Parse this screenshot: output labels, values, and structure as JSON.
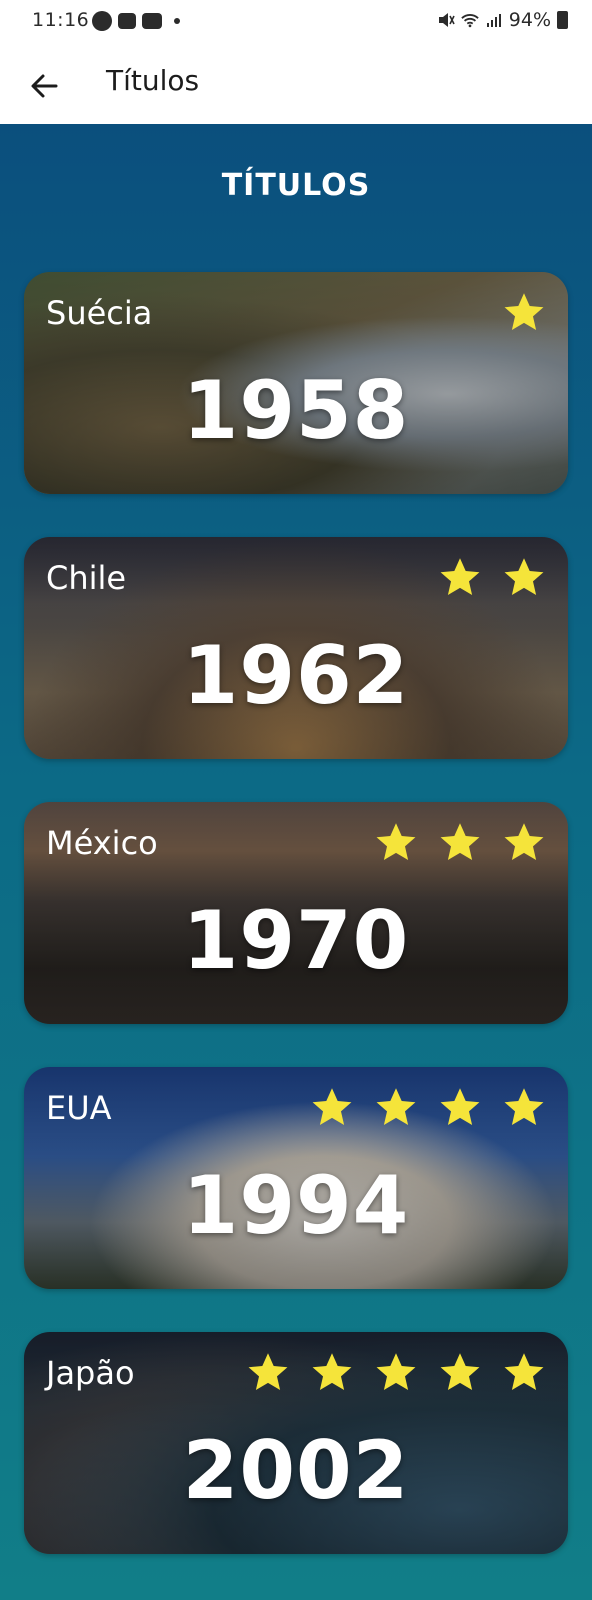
{
  "status_bar": {
    "time": "11:16",
    "battery": "94%"
  },
  "app_bar": {
    "title": "Títulos"
  },
  "section_title": "TÍTULOS",
  "colors": {
    "star": "#f5e43a",
    "header_bg": "#ffffff",
    "content_top": "#0b4f7d",
    "content_bottom": "#117e88"
  },
  "titles": [
    {
      "country": "Suécia",
      "year": "1958",
      "stars": 1
    },
    {
      "country": "Chile",
      "year": "1962",
      "stars": 2
    },
    {
      "country": "México",
      "year": "1970",
      "stars": 3
    },
    {
      "country": "EUA",
      "year": "1994",
      "stars": 4
    },
    {
      "country": "Japão",
      "year": "2002",
      "stars": 5
    }
  ]
}
